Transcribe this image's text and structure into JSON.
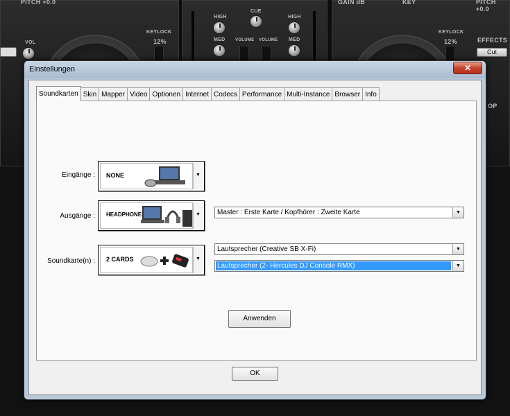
{
  "background": {
    "left_header": "PITCH +0.0",
    "right_header_gain": "GAIN dB",
    "right_header_key": "KEY",
    "right_header_pitch": "PITCH +0.0",
    "vol": "VOL",
    "keylock_left": "KEYLOCK",
    "keylock_right": "KEYLOCK",
    "pct_left": "12%",
    "pct_right": "12%",
    "high_left": "HIGH",
    "high_right": "HIGH",
    "med_left": "MED",
    "med_right": "MED",
    "cue": "CUE",
    "volume_left": "VOLUME",
    "volume_right": "VOLUME",
    "effects": "EFFECTS",
    "cut": "Cut",
    "op": "OP"
  },
  "dialog": {
    "title": "Einstellungen",
    "close_glyph": "✕",
    "tabs": [
      "Soundkarten",
      "Skin",
      "Mapper",
      "Video",
      "Optionen",
      "Internet",
      "Codecs",
      "Performance",
      "Multi-Instance",
      "Browser",
      "Info"
    ],
    "active_tab": "Soundkarten",
    "inputs": {
      "label": "Eingänge :",
      "picture_label": "NONE"
    },
    "outputs": {
      "label": "Ausgänge :",
      "picture_label": "HEADPHONES",
      "combo_value": "Master : Erste Karte / Kopfhörer : Zweite Karte"
    },
    "soundcards": {
      "label": "Soundkarte(n) :",
      "picture_label": "2 CARDS",
      "combo1_value": "Lautsprecher (Creative SB X-Fi)",
      "combo2_value": "Lautsprecher (2- Hercules DJ Console RMX)"
    },
    "apply_label": "Anwenden",
    "ok_label": "OK"
  },
  "colors": {
    "dialog_frame": "#b9c9d9",
    "selection": "#3399ff",
    "close": "#c7422a"
  }
}
